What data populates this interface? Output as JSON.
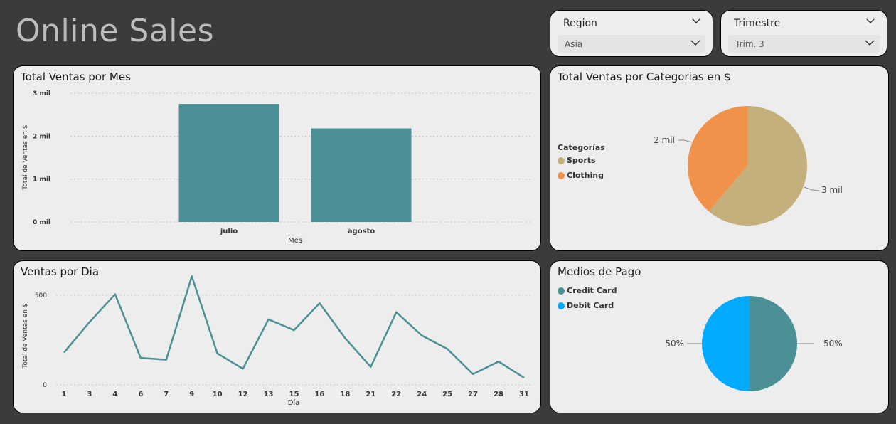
{
  "page_title": "Online Sales",
  "slicers": [
    {
      "label": "Region",
      "value": "Asia"
    },
    {
      "label": "Trimestre",
      "value": "Trim. 3"
    }
  ],
  "colors": {
    "teal": "#4a9095",
    "sports": "#c4b07c",
    "clothing": "#f0924a",
    "credit": "#4a9095",
    "debit": "#00aaff"
  },
  "chart_data": [
    {
      "type": "bar",
      "title": "Total Ventas por Mes",
      "categories": [
        "julio",
        "agosto"
      ],
      "values": [
        2750,
        2180
      ],
      "xlabel": "Mes",
      "ylabel": "Total de Ventas en $",
      "ylim": [
        0,
        3000
      ],
      "yticks": [
        0,
        1000,
        2000,
        3000
      ],
      "ytick_labels": [
        "0 mil",
        "1 mil",
        "2 mil",
        "3 mil"
      ],
      "grid": true
    },
    {
      "type": "pie",
      "title": "Total Ventas por Categorias en $",
      "legend_title": "Categorías",
      "legend_position": "left",
      "slices": [
        {
          "label": "Sports",
          "value": 3000,
          "data_label": "3 mil"
        },
        {
          "label": "Clothing",
          "value": 1900,
          "data_label": "2 mil"
        }
      ]
    },
    {
      "type": "line",
      "title": "Ventas por Dia",
      "xlabel": "Día",
      "ylabel": "Total de Ventas en $",
      "x": [
        "1",
        "3",
        "4",
        "6",
        "7",
        "9",
        "10",
        "12",
        "13",
        "15",
        "16",
        "18",
        "21",
        "22",
        "24",
        "25",
        "27",
        "28",
        "31"
      ],
      "values": [
        180,
        350,
        505,
        150,
        140,
        605,
        175,
        90,
        365,
        305,
        455,
        260,
        100,
        405,
        275,
        200,
        60,
        130,
        40
      ],
      "ylim": [
        0,
        650
      ],
      "yticks": [
        0,
        500
      ],
      "ytick_labels": [
        "0",
        "500"
      ],
      "grid": true
    },
    {
      "type": "pie",
      "title": "Medios de Pago",
      "legend_position": "top-left",
      "slices": [
        {
          "label": "Credit Card",
          "value": 50,
          "data_label": "50%"
        },
        {
          "label": "Debit Card",
          "value": 50,
          "data_label": "50%"
        }
      ]
    }
  ]
}
